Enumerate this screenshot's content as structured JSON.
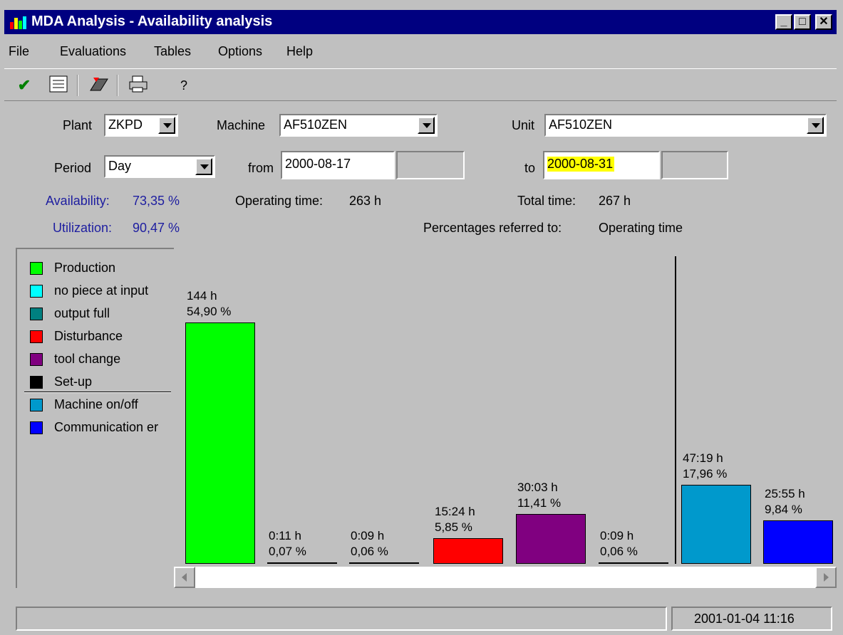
{
  "window": {
    "title": "MDA Analysis - Availability analysis",
    "min": "_",
    "max": "□",
    "close": "✕"
  },
  "menu": [
    "File",
    "Evaluations",
    "Tables",
    "Options",
    "Help"
  ],
  "toolbar": {
    "help": "?"
  },
  "form": {
    "plant_label": "Plant",
    "plant_value": "ZKPD",
    "machine_label": "Machine",
    "machine_value": "AF510ZEN",
    "unit_label": "Unit",
    "unit_value": "AF510ZEN",
    "period_label": "Period",
    "period_value": "Day",
    "from_label": "from",
    "from_value": "2000-08-17",
    "to_label": "to",
    "to_value": "2000-08-31"
  },
  "stats": {
    "availability_label": "Availability:",
    "availability_value": "73,35 %",
    "utilization_label": "Utilization:",
    "utilization_value": "90,47 %",
    "operating_label": "Operating time:",
    "operating_value": "263 h",
    "total_label": "Total time:",
    "total_value": "267 h",
    "percent_label": "Percentages referred to:",
    "percent_value": "Operating time"
  },
  "legend": [
    {
      "label": "Production",
      "color": "#00ff00"
    },
    {
      "label": "no piece at input",
      "color": "#00ffff"
    },
    {
      "label": "output full",
      "color": "#008080"
    },
    {
      "label": "Disturbance",
      "color": "#ff0000"
    },
    {
      "label": "tool change",
      "color": "#800080"
    },
    {
      "label": "Set-up",
      "color": "#000000"
    },
    {
      "label": "Machine on/off",
      "color": "#0099cc"
    },
    {
      "label": "Communication er",
      "color": "#0000ff"
    }
  ],
  "chart_data": {
    "type": "bar",
    "categories": [
      "Production",
      "no piece at input",
      "output full",
      "Disturbance",
      "tool change",
      "Set-up",
      "Machine on/off",
      "Communication error"
    ],
    "values": [
      54.9,
      0.07,
      0.06,
      5.85,
      11.41,
      0.06,
      17.96,
      9.84
    ],
    "hours": [
      "144 h",
      "0:11 h",
      "0:09 h",
      "15:24 h",
      "30:03 h",
      "0:09 h",
      "47:19 h",
      "25:55 h"
    ],
    "percents": [
      "54,90 %",
      "0,07 %",
      "0,06 %",
      "5,85 %",
      "11,41 %",
      "0,06 %",
      "17,96 %",
      "9,84 %"
    ],
    "colors": [
      "#00ff00",
      "#00ffff",
      "#008080",
      "#ff0000",
      "#800080",
      "#000000",
      "#0099cc",
      "#0000ff"
    ],
    "ylim": [
      0,
      60
    ]
  },
  "status": {
    "datetime": "2001-01-04  11:16"
  }
}
